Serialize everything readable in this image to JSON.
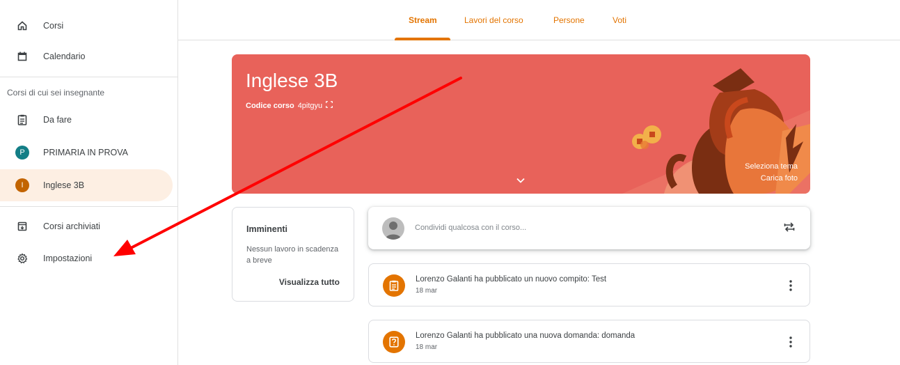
{
  "sidebar": {
    "items": [
      {
        "label": "Corsi",
        "icon": "home-icon"
      },
      {
        "label": "Calendario",
        "icon": "calendar-icon"
      }
    ],
    "section_title": "Corsi di cui sei insegnante",
    "teaching": [
      {
        "label": "Da fare",
        "icon": "assignment-icon"
      },
      {
        "label": "PRIMARIA IN PROVA",
        "avatar": "P",
        "avatar_color": "#137e86"
      },
      {
        "label": "Inglese 3B",
        "avatar": "I",
        "avatar_color": "#c26401"
      }
    ],
    "bottom": [
      {
        "label": "Corsi archiviati",
        "icon": "archive-icon"
      },
      {
        "label": "Impostazioni",
        "icon": "settings-icon"
      }
    ]
  },
  "tabs": [
    {
      "label": "Stream",
      "active": true
    },
    {
      "label": "Lavori del corso"
    },
    {
      "label": "Persone"
    },
    {
      "label": "Voti"
    }
  ],
  "banner": {
    "title": "Inglese 3B",
    "code_label": "Codice corso",
    "code_value": "4pitgyu",
    "select_theme": "Seleziona tema",
    "upload_photo": "Carica foto",
    "color": "#e8625a"
  },
  "upcoming": {
    "title": "Imminenti",
    "text": "Nessun lavoro in scadenza a breve",
    "link": "Visualizza tutto"
  },
  "share": {
    "placeholder": "Condividi qualcosa con il corso..."
  },
  "posts": [
    {
      "title": "Lorenzo Galanti ha pubblicato un nuovo compito: Test",
      "date": "18 mar",
      "icon": "assignment-icon"
    },
    {
      "title": "Lorenzo Galanti ha pubblicato una nuova domanda: domanda",
      "date": "18 mar",
      "icon": "question-icon"
    }
  ],
  "colors": {
    "accent": "#e37400",
    "annotation_arrow": "#ff0000"
  }
}
